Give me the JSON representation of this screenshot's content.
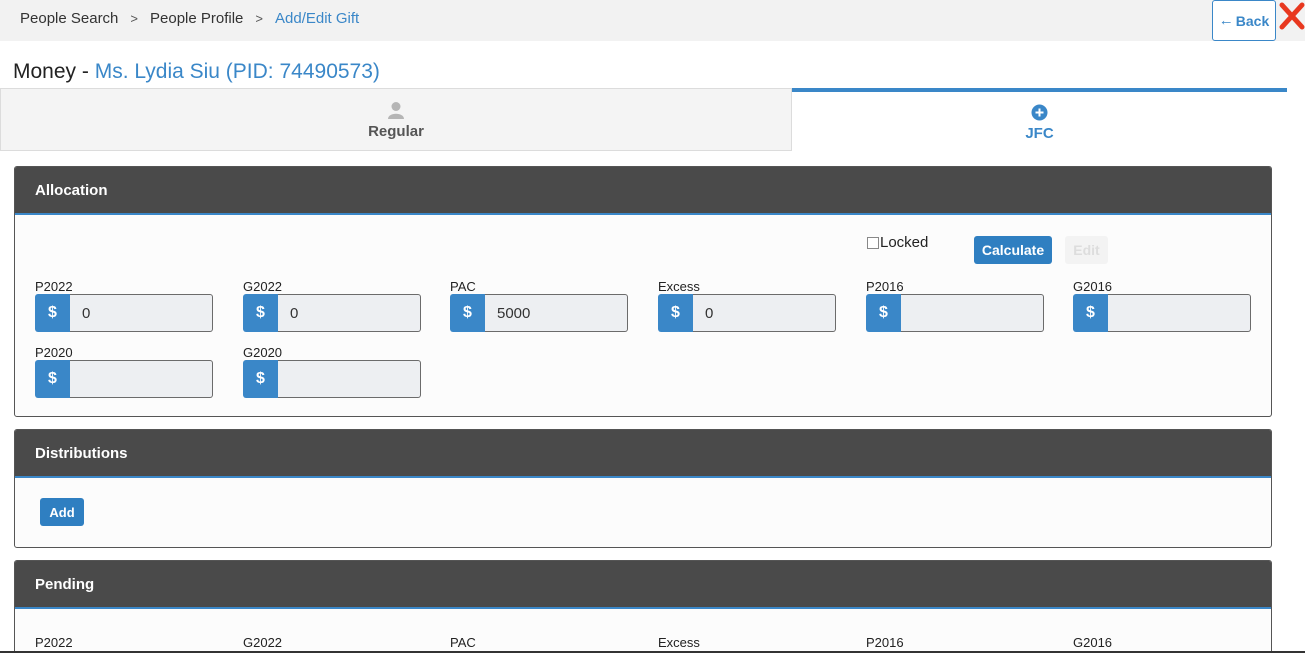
{
  "breadcrumb": {
    "items": [
      "People Search",
      "People Profile",
      "Add/Edit Gift"
    ],
    "separator": ">"
  },
  "header": {
    "back_label": "Back",
    "close_icon": "close-icon",
    "close_color": "#e8381f"
  },
  "title": {
    "prefix": "Money - ",
    "person": "Ms. Lydia Siu (PID: 74490573)"
  },
  "tabs": [
    {
      "label": "Regular",
      "icon": "user-icon",
      "active": false
    },
    {
      "label": "JFC",
      "icon": "plus-circle-icon",
      "active": true
    }
  ],
  "allocation": {
    "title": "Allocation",
    "locked_label": "Locked",
    "locked_checked": false,
    "calculate_label": "Calculate",
    "edit_label": "Edit",
    "currency_symbol": "$",
    "fields": [
      {
        "label": "P2022",
        "value": "0"
      },
      {
        "label": "G2022",
        "value": "0"
      },
      {
        "label": "PAC",
        "value": "5000"
      },
      {
        "label": "Excess",
        "value": "0"
      },
      {
        "label": "P2016",
        "value": ""
      },
      {
        "label": "G2016",
        "value": ""
      },
      {
        "label": "P2020",
        "value": ""
      },
      {
        "label": "G2020",
        "value": ""
      }
    ]
  },
  "distributions": {
    "title": "Distributions",
    "add_label": "Add"
  },
  "pending": {
    "title": "Pending",
    "labels": [
      "P2022",
      "G2022",
      "PAC",
      "Excess",
      "P2016",
      "G2016"
    ]
  },
  "colors": {
    "accent": "#3a87c8",
    "panel_header": "#4a4a4a",
    "button": "#2f7fc1"
  }
}
